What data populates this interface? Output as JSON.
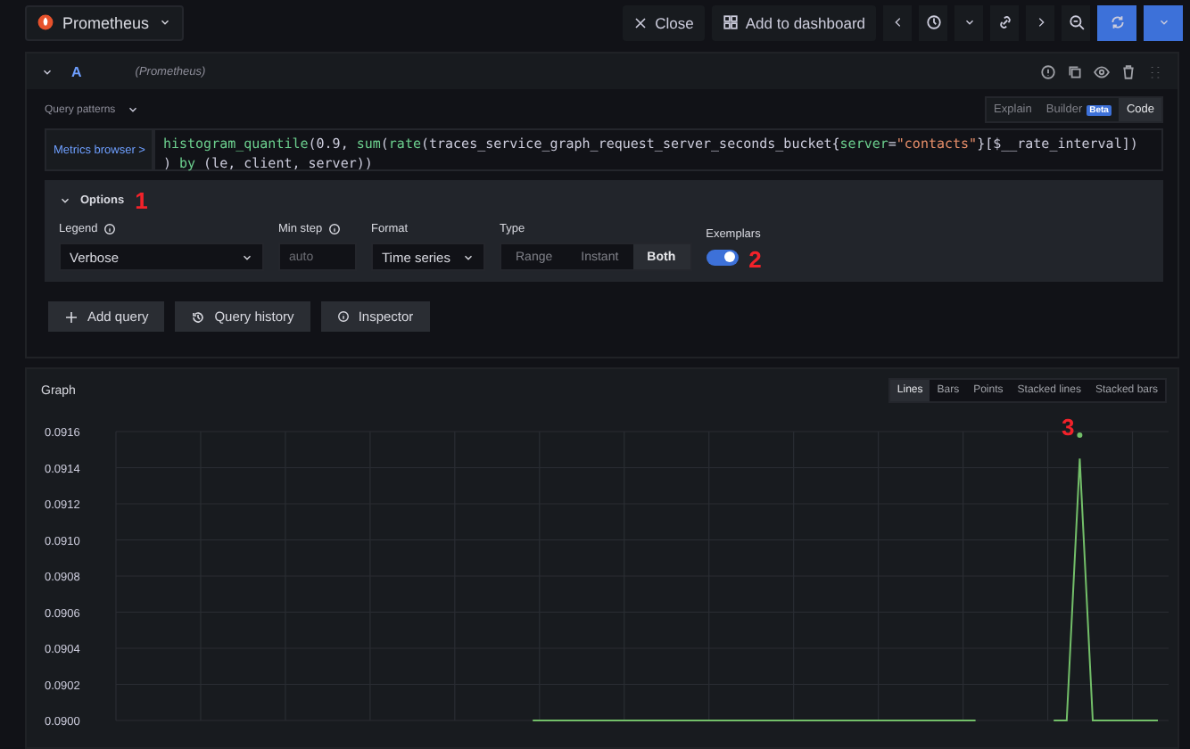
{
  "topbar": {
    "datasource": "Prometheus",
    "buttons": [
      {
        "label": "Close",
        "kind": "close"
      },
      {
        "label": "Add to dashboard",
        "kind": "dashboard"
      }
    ]
  },
  "query": {
    "ref": "A",
    "datasource": "(Prometheus)",
    "patterns": "Query patterns",
    "browser": "Metrics browser >",
    "modes": [
      {
        "label": "Explain",
        "selected": false
      },
      {
        "label": "Builder",
        "badge": "Beta",
        "selected": false
      },
      {
        "label": "Code",
        "selected": true
      }
    ],
    "lines": [
      [
        {
          "text": "histogram_quantile",
          "kind": "func"
        },
        {
          "text": "(0.9, ",
          "kind": "plain"
        },
        {
          "text": "sum",
          "kind": "func"
        },
        {
          "text": "(",
          "kind": "plain"
        },
        {
          "text": "rate",
          "kind": "func"
        },
        {
          "text": "(traces_service_graph_request_server_seconds_bucket{",
          "kind": "plain"
        },
        {
          "text": "server",
          "kind": "label"
        },
        {
          "text": "=",
          "kind": "plain"
        },
        {
          "text": "\"contacts\"",
          "kind": "string"
        },
        {
          "text": "}[$__rate_interval])",
          "kind": "plain"
        }
      ],
      [
        {
          "text": ") ",
          "kind": "plain"
        },
        {
          "text": "by",
          "kind": "func"
        },
        {
          "text": " (le, client, server))",
          "kind": "plain"
        }
      ]
    ]
  },
  "options": {
    "title": "Options",
    "expanded": true,
    "marker": "1",
    "legend": {
      "label": "Legend",
      "value": "Verbose"
    },
    "min_step": {
      "label": "Min step",
      "placeholder": "auto"
    },
    "format": {
      "label": "Format",
      "value": "Time series"
    },
    "type": {
      "label": "Type",
      "options": [
        {
          "label": "Range",
          "selected": false
        },
        {
          "label": "Instant",
          "selected": false
        },
        {
          "label": "Both",
          "selected": true
        }
      ]
    },
    "exemplars": {
      "label": "Exemplars",
      "on": true,
      "marker": "2"
    }
  },
  "actions": [
    {
      "label": "Add query",
      "kind": "add"
    },
    {
      "label": "Query history",
      "kind": "history"
    },
    {
      "label": "Inspector",
      "kind": "info"
    }
  ],
  "graph": {
    "title": "Graph",
    "marker": "3",
    "styles": [
      {
        "label": "Lines",
        "selected": true
      },
      {
        "label": "Bars",
        "selected": false
      },
      {
        "label": "Points",
        "selected": false
      },
      {
        "label": "Stacked lines",
        "selected": false
      },
      {
        "label": "Stacked bars",
        "selected": false
      }
    ],
    "chart_data": {
      "type": "line",
      "grid": true,
      "categories": [
        null,
        null,
        null,
        null,
        null,
        null,
        null,
        null,
        null,
        null,
        null,
        null,
        null,
        null,
        null,
        null,
        null,
        null,
        null,
        null,
        null,
        null,
        null,
        null,
        null,
        null,
        null,
        null,
        null,
        null,
        null,
        null,
        null,
        null,
        null,
        null,
        null,
        null,
        null,
        null,
        null,
        null,
        null,
        null,
        null,
        null,
        null,
        null,
        null,
        null,
        null,
        null,
        null,
        null,
        null,
        null,
        null,
        null,
        null,
        null,
        null,
        null,
        null,
        null,
        null,
        null,
        null,
        null,
        null,
        null,
        null,
        null,
        null,
        null,
        null,
        null,
        null,
        null,
        null,
        null,
        null
      ],
      "ylim": [
        0.09,
        0.0916
      ],
      "yticks": [
        {
          "value": 0.09,
          "label": "0.0900"
        },
        {
          "value": 0.0902,
          "label": "0.0902"
        },
        {
          "value": 0.0904,
          "label": "0.0904"
        },
        {
          "value": 0.0906,
          "label": "0.0906"
        },
        {
          "value": 0.0908,
          "label": "0.0908"
        },
        {
          "value": 0.091,
          "label": "0.0910"
        },
        {
          "value": 0.0912,
          "label": "0.0912"
        },
        {
          "value": 0.0914,
          "label": "0.0914"
        },
        {
          "value": 0.0916,
          "label": "0.0916"
        }
      ],
      "series": [
        {
          "color": "#73bf69",
          "values": [
            null,
            null,
            null,
            null,
            null,
            null,
            null,
            null,
            null,
            null,
            null,
            null,
            null,
            null,
            null,
            null,
            null,
            null,
            null,
            null,
            null,
            null,
            null,
            null,
            null,
            null,
            null,
            null,
            null,
            null,
            null,
            null,
            0.09,
            0.09,
            0.09,
            0.09,
            0.09,
            0.09,
            0.09,
            0.09,
            0.09,
            0.09,
            0.09,
            0.09,
            0.09,
            0.09,
            0.09,
            0.09,
            0.09,
            0.09,
            0.09,
            0.09,
            0.09,
            0.09,
            0.09,
            0.09,
            0.09,
            0.09,
            0.09,
            0.09,
            0.09,
            0.09,
            0.09,
            0.09,
            0.09,
            0.09,
            0.09,
            null,
            null,
            null,
            null,
            null,
            0.09,
            0.09,
            0.09145,
            0.09,
            0.09,
            0.09,
            0.09,
            0.09,
            0.09
          ]
        }
      ]
    }
  }
}
